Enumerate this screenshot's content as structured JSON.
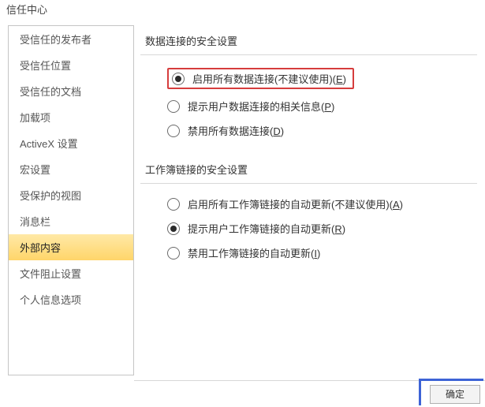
{
  "title": "信任中心",
  "sidebar": {
    "items": [
      {
        "label": "受信任的发布者"
      },
      {
        "label": "受信任位置"
      },
      {
        "label": "受信任的文档"
      },
      {
        "label": "加载项"
      },
      {
        "label": "ActiveX 设置"
      },
      {
        "label": "宏设置"
      },
      {
        "label": "受保护的视图"
      },
      {
        "label": "消息栏"
      },
      {
        "label": "外部内容"
      },
      {
        "label": "文件阻止设置"
      },
      {
        "label": "个人信息选项"
      }
    ],
    "selected_index": 8
  },
  "sections": [
    {
      "title": "数据连接的安全设置",
      "options": [
        {
          "label_main": "启用所有数据连接(不建议使用)(",
          "hotkey": "E",
          "label_tail": ")",
          "checked": true,
          "highlighted": true
        },
        {
          "label_main": "提示用户数据连接的相关信息(",
          "hotkey": "P",
          "label_tail": ")",
          "checked": false,
          "highlighted": false
        },
        {
          "label_main": "禁用所有数据连接(",
          "hotkey": "D",
          "label_tail": ")",
          "checked": false,
          "highlighted": false
        }
      ]
    },
    {
      "title": "工作簿链接的安全设置",
      "options": [
        {
          "label_main": "启用所有工作簿链接的自动更新(不建议使用)(",
          "hotkey": "A",
          "label_tail": ")",
          "checked": false,
          "highlighted": false
        },
        {
          "label_main": "提示用户工作簿链接的自动更新(",
          "hotkey": "R",
          "label_tail": ")",
          "checked": true,
          "highlighted": false
        },
        {
          "label_main": "禁用工作簿链接的自动更新(",
          "hotkey": "I",
          "label_tail": ")",
          "checked": false,
          "highlighted": false
        }
      ]
    }
  ],
  "footer": {
    "ok_label": "确定"
  }
}
